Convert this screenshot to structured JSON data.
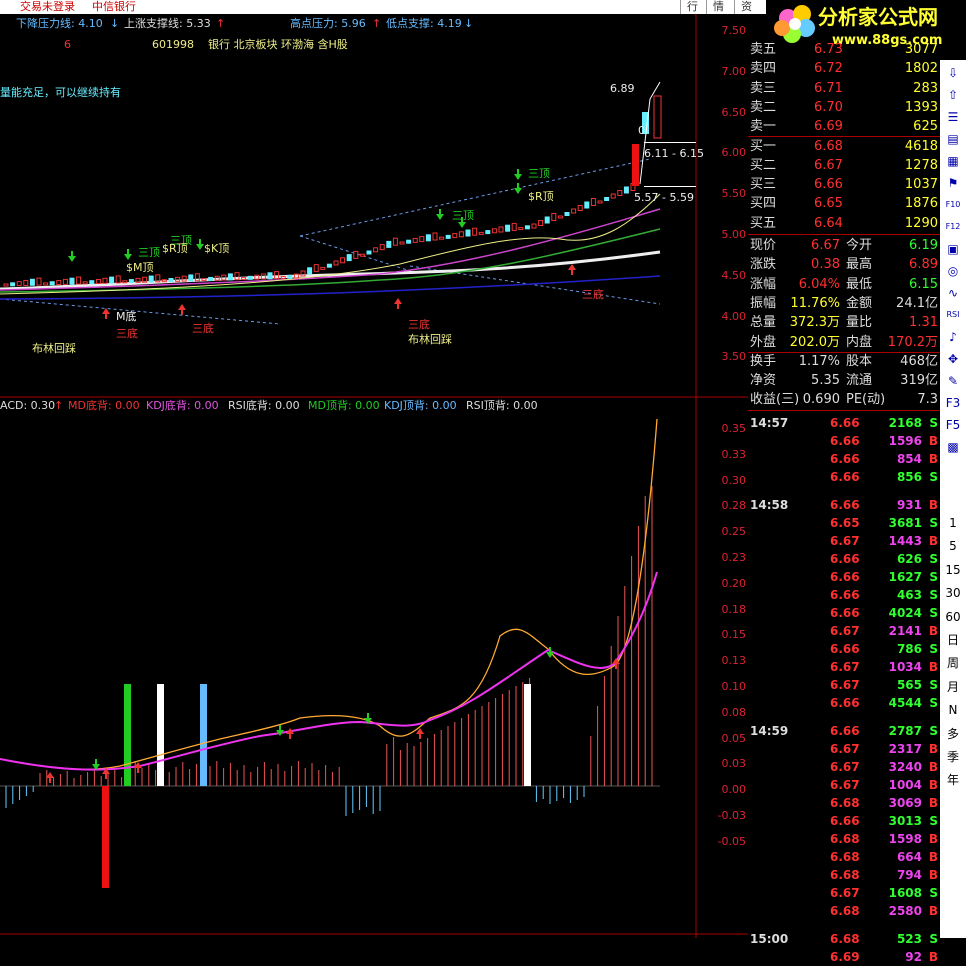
{
  "topbar": {
    "login": "交易未登录",
    "stock_name": "中信银行",
    "btn_trade": "行",
    "btn_quote": "情",
    "btn_settle": "资"
  },
  "logo": {
    "name": "分析家公式网",
    "url": "www.88gs.com"
  },
  "header": {
    "down_pressure": "下降压力线: 4.10",
    "up_support": "上涨支撑线: 5.33",
    "high_pressure": "高点压力: 5.96",
    "low_support": "低点支撑: 4.19",
    "num6": "6",
    "code": "601998",
    "tags": "银行 北京板块 环渤海 含H股",
    "advice": "量能充足，可以继续持有"
  },
  "main_axis": [
    "7.50",
    "7.00",
    "6.50",
    "6.00",
    "5.50",
    "5.00",
    "4.50",
    "4.00",
    "3.50"
  ],
  "main_labels": {
    "peak": "6.89",
    "zero": "0",
    "range1": "6.11 - 6.15",
    "range2": "5.57 - 5.59",
    "three_top1": "三顶",
    "three_top2": "三顶",
    "three_top3": "三顶",
    "three_top4": "三顶",
    "r_top": "$R顶",
    "r_top2": "$R顶",
    "k_top": "$K顶",
    "m_top": "$M顶",
    "m_bottom": "M底",
    "three_bottom1": "三底",
    "three_bottom2": "三底",
    "three_bottom3": "三底",
    "boll1": "布林回踩",
    "boll2": "布林回踩",
    "three_bottom4": "三底"
  },
  "sub_header": {
    "macd": "ACD: 0.30",
    "md_bottom": "MD底背: 0.00",
    "kdj_bottom": "KDJ底背: 0.00",
    "rsi_bottom": "RSI底背: 0.00",
    "md_top": "MD顶背: 0.00",
    "kdj_top": "KDJ顶背: 0.00",
    "rsi_top": "RSI顶背: 0.00"
  },
  "sub_axis": [
    "0.35",
    "0.33",
    "0.30",
    "0.28",
    "0.25",
    "0.23",
    "0.20",
    "0.18",
    "0.15",
    "0.13",
    "0.10",
    "0.08",
    "0.05",
    "0.03",
    "0.00",
    "-0.03",
    "-0.05"
  ],
  "order_book": [
    {
      "label": "卖五",
      "price": "6.73",
      "vol": "3077"
    },
    {
      "label": "卖四",
      "price": "6.72",
      "vol": "1802"
    },
    {
      "label": "卖三",
      "price": "6.71",
      "vol": "283"
    },
    {
      "label": "卖二",
      "price": "6.70",
      "vol": "1393"
    },
    {
      "label": "卖一",
      "price": "6.69",
      "vol": "625"
    },
    {
      "label": "买一",
      "price": "6.68",
      "vol": "4618"
    },
    {
      "label": "买二",
      "price": "6.67",
      "vol": "1278"
    },
    {
      "label": "买三",
      "price": "6.66",
      "vol": "1037"
    },
    {
      "label": "买四",
      "price": "6.65",
      "vol": "1876"
    },
    {
      "label": "买五",
      "price": "6.64",
      "vol": "1290"
    }
  ],
  "stats": [
    {
      "l1": "现价",
      "v1": "6.67",
      "l2": "今开",
      "v2": "6.19"
    },
    {
      "l1": "涨跌",
      "v1": "0.38",
      "l2": "最高",
      "v2": "6.89"
    },
    {
      "l1": "涨幅",
      "v1": "6.04%",
      "l2": "最低",
      "v2": "6.15"
    },
    {
      "l1": "振幅",
      "v1": "11.76%",
      "l2": "金额",
      "v2": "24.1亿"
    },
    {
      "l1": "总量",
      "v1": "372.3万",
      "l2": "量比",
      "v2": "1.31"
    },
    {
      "l1": "外盘",
      "v1": "202.0万",
      "l2": "内盘",
      "v2": "170.2万"
    },
    {
      "l1": "换手",
      "v1": "1.17%",
      "l2": "股本",
      "v2": "468亿"
    },
    {
      "l1": "净资",
      "v1": "5.35",
      "l2": "流通",
      "v2": "319亿"
    },
    {
      "l1": "收益(三)",
      "v1": "0.690",
      "l2": "PE(动)",
      "v2": "7.3"
    }
  ],
  "ticks": [
    {
      "t": "14:57",
      "p": "6.66",
      "v": "2168",
      "s": "S"
    },
    {
      "t": "",
      "p": "6.66",
      "v": "1596",
      "s": "B"
    },
    {
      "t": "",
      "p": "6.66",
      "v": "854",
      "s": "B"
    },
    {
      "t": "",
      "p": "6.66",
      "v": "856",
      "s": "S"
    },
    {
      "t": "14:58",
      "p": "6.66",
      "v": "931",
      "s": "B"
    },
    {
      "t": "",
      "p": "6.65",
      "v": "3681",
      "s": "S"
    },
    {
      "t": "",
      "p": "6.67",
      "v": "1443",
      "s": "B"
    },
    {
      "t": "",
      "p": "6.66",
      "v": "626",
      "s": "S"
    },
    {
      "t": "",
      "p": "6.66",
      "v": "1627",
      "s": "S"
    },
    {
      "t": "",
      "p": "6.66",
      "v": "463",
      "s": "S"
    },
    {
      "t": "",
      "p": "6.66",
      "v": "4024",
      "s": "S"
    },
    {
      "t": "",
      "p": "6.67",
      "v": "2141",
      "s": "B"
    },
    {
      "t": "",
      "p": "6.66",
      "v": "786",
      "s": "S"
    },
    {
      "t": "",
      "p": "6.67",
      "v": "1034",
      "s": "B"
    },
    {
      "t": "",
      "p": "6.67",
      "v": "565",
      "s": "S"
    },
    {
      "t": "",
      "p": "6.66",
      "v": "4544",
      "s": "S"
    },
    {
      "t": "14:59",
      "p": "6.66",
      "v": "2787",
      "s": "S"
    },
    {
      "t": "",
      "p": "6.67",
      "v": "2317",
      "s": "B"
    },
    {
      "t": "",
      "p": "6.67",
      "v": "3240",
      "s": "B"
    },
    {
      "t": "",
      "p": "6.67",
      "v": "1004",
      "s": "B"
    },
    {
      "t": "",
      "p": "6.68",
      "v": "3069",
      "s": "B"
    },
    {
      "t": "",
      "p": "6.66",
      "v": "3013",
      "s": "S"
    },
    {
      "t": "",
      "p": "6.68",
      "v": "1598",
      "s": "B"
    },
    {
      "t": "",
      "p": "6.68",
      "v": "664",
      "s": "B"
    },
    {
      "t": "",
      "p": "6.68",
      "v": "794",
      "s": "B"
    },
    {
      "t": "",
      "p": "6.67",
      "v": "1608",
      "s": "S"
    },
    {
      "t": "",
      "p": "6.68",
      "v": "2580",
      "s": "B"
    },
    {
      "t": "15:00",
      "p": "6.68",
      "v": "523",
      "s": "S"
    },
    {
      "t": "",
      "p": "6.69",
      "v": "92",
      "s": "B"
    }
  ],
  "toolbar": [
    "1",
    "5",
    "15",
    "30",
    "60",
    "日",
    "周",
    "月",
    "N",
    "多",
    "季",
    "年"
  ]
}
